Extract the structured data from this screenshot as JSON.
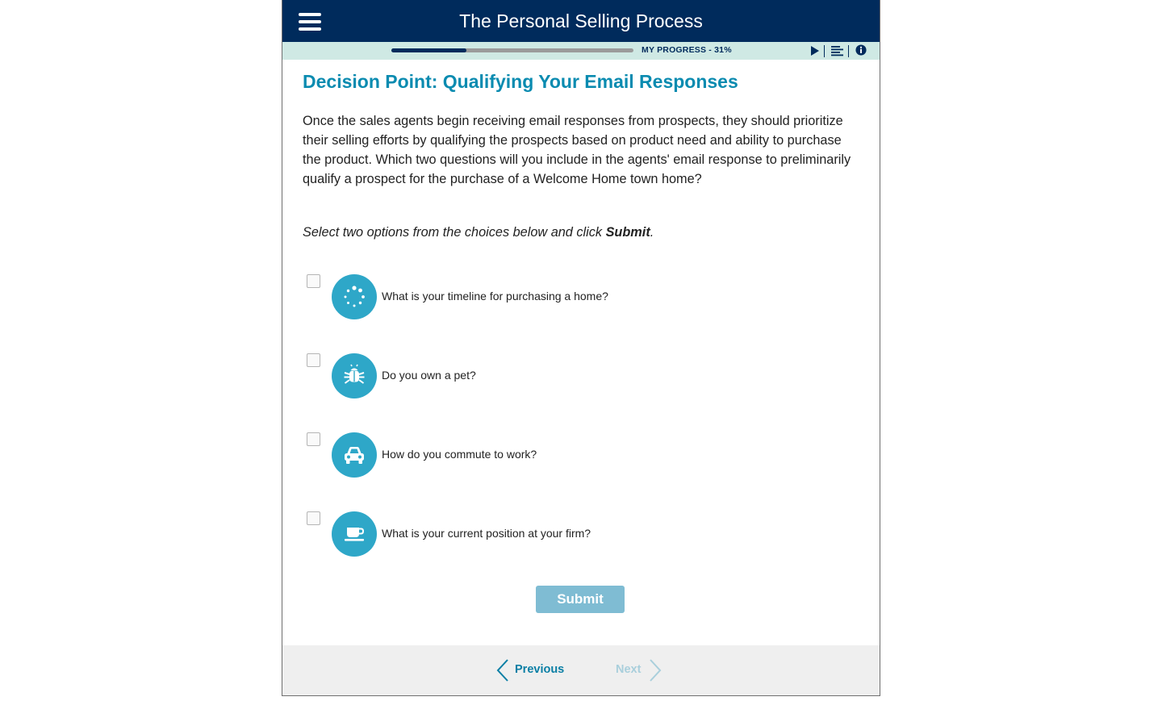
{
  "header": {
    "title": "The Personal Selling Process",
    "menu_icon": "hamburger-menu-icon"
  },
  "progress": {
    "label": "MY PROGRESS - 31%",
    "value": 0.31
  },
  "toolbar": {
    "icons": [
      "play-icon",
      "transcript-icon",
      "info-icon"
    ]
  },
  "colors": {
    "header_bg": "#002b5c",
    "progress_strip_bg": "#cfe9e4",
    "heading": "#0a8bb0",
    "icon_circle": "#2ea7c8",
    "submit_disabled": "#7fbcd3",
    "nav_active": "#0a7fa5",
    "nav_disabled": "#a9cfdc"
  },
  "main": {
    "heading": "Decision Point: Qualifying Your Email Responses",
    "body": "Once the sales agents begin receiving email responses from prospects, they should prioritize their selling efforts by qualifying the prospects based on product need and ability to purchase the product. Which two questions will you include in the agents' email response to preliminarily qualify a prospect for the purchase of a Welcome Home town home?",
    "instruction_prefix": "Select two options from the choices below and click ",
    "instruction_bold": "Submit",
    "instruction_suffix": "."
  },
  "options": [
    {
      "text": "What is your timeline for purchasing a home?",
      "icon": "loading-spinner-icon",
      "checked": false
    },
    {
      "text": "Do you own a pet?",
      "icon": "bug-icon",
      "checked": false
    },
    {
      "text": "How do you commute to work?",
      "icon": "car-icon",
      "checked": false
    },
    {
      "text": "What is your current position at your firm?",
      "icon": "coffee-cup-icon",
      "checked": false
    }
  ],
  "submit": {
    "label": "Submit"
  },
  "footer": {
    "previous_label": "Previous",
    "next_label": "Next"
  }
}
